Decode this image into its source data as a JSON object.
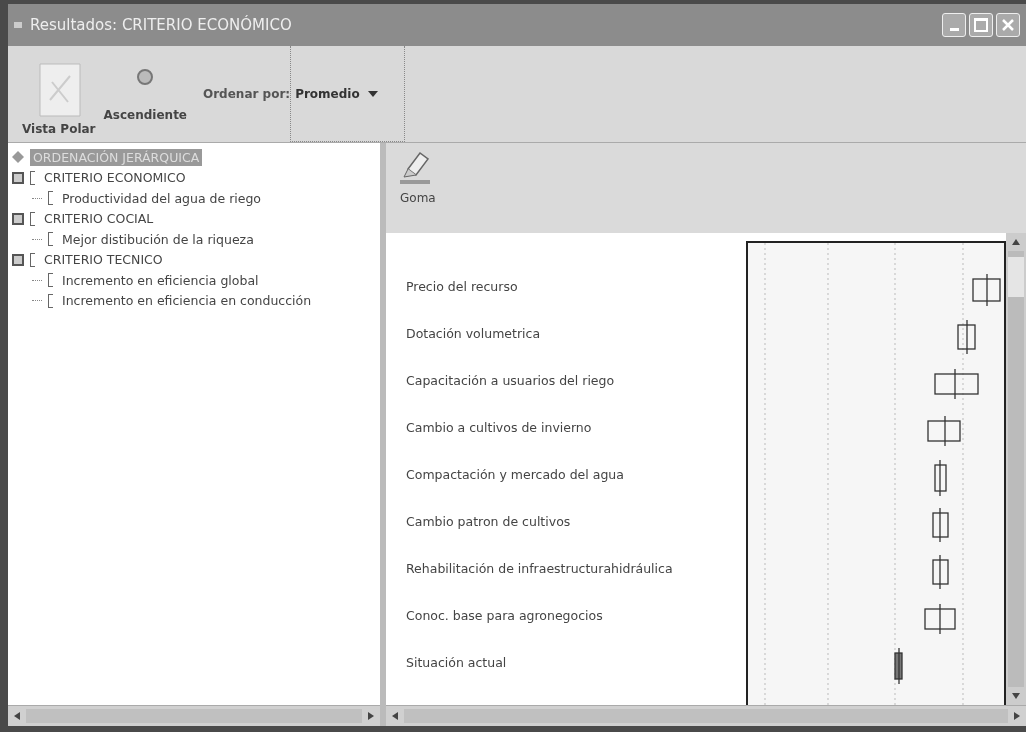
{
  "window": {
    "title": "Resultados: CRITERIO ECONÓMICO"
  },
  "toolbar": {
    "buttons": [
      {
        "label": "Vista Polar",
        "kind": "polar"
      },
      {
        "label": "Ascendiente",
        "kind": "order"
      }
    ],
    "sort": {
      "label": "Ordenar por:",
      "value": "Promedio"
    }
  },
  "tree": {
    "label": "ORDENACIÓN JERÁRQUICA",
    "selected": true,
    "children": [
      {
        "label": "CRITERIO ECONOMICO",
        "selected": false,
        "expanded": true,
        "children": [
          {
            "label": "Productividad del agua de riego",
            "selected": false
          }
        ]
      },
      {
        "label": "CRITERIO COCIAL",
        "selected": false,
        "expanded": true,
        "children": [
          {
            "label": "Mejor distibución de la riqueza",
            "selected": false
          }
        ]
      },
      {
        "label": "CRITERIO TECNICO",
        "selected": false,
        "expanded": true,
        "children": [
          {
            "label": "Incremento en eficiencia global",
            "selected": false
          },
          {
            "label": "Incremento en eficiencia en conducción",
            "selected": false
          }
        ]
      }
    ]
  },
  "tool": {
    "label": "Goma"
  },
  "alternatives": [
    "Precio del recurso",
    "Dotación volumetrica",
    "Capacitación a usuarios del riego",
    "Cambio a cultivos de invierno",
    "Compactación y mercado del agua",
    "Cambio patron de cultivos",
    "Rehabilitación de infraestructurahidráulica",
    "Conoc. base para agronegocios",
    "Situación actual"
  ]
}
